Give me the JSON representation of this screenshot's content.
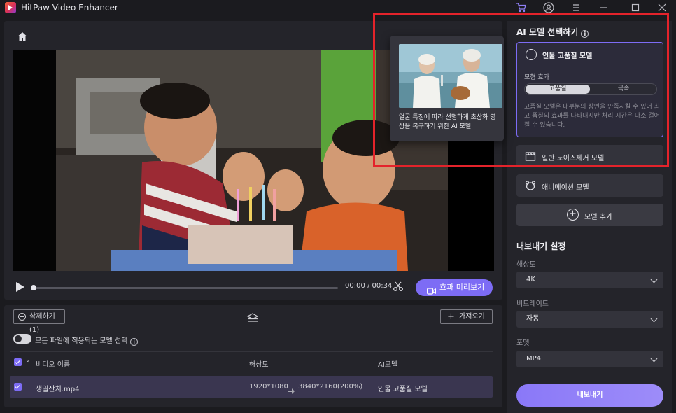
{
  "app": {
    "title": "HitPaw Video Enhancer"
  },
  "titlebar_icons": [
    "cart-icon",
    "account-icon",
    "menu-icon",
    "minimize-icon",
    "maximize-icon",
    "close-icon"
  ],
  "player": {
    "time": "00:00 / 00:34",
    "progress": 0.0,
    "preview_label": "효과 미리보기"
  },
  "file_list": {
    "delete_label": "삭제하기(1)",
    "import_label": "가져오기",
    "apply_all_label": "모든 파일에 적용되는 모델 선택",
    "apply_all_on": false,
    "columns": {
      "name": "비디오 이름",
      "resolution": "해상도",
      "model": "AI모델"
    },
    "rows": [
      {
        "name": "생일잔치.mp4",
        "res_from": "1920*1080",
        "res_to": "3840*2160(200%)",
        "model": "인물 고품질 모델",
        "checked": true
      }
    ]
  },
  "models": {
    "title": "AI 모델 선택하기",
    "active": {
      "title": "인물 고품질 모델",
      "effect_label": "모형 효과",
      "options": [
        "고품질",
        "극속"
      ],
      "selected": "고품질",
      "description": "고품질 모델은 대부분의 장면을 만족시킬 수 있어 최고 품질의 효과를 나타내지만 처리 시간은 다소 걸어질 수 있습니다."
    },
    "others": [
      {
        "label": "일반 노이즈제거 모델",
        "icon": "clapper-icon"
      },
      {
        "label": "애니메이션 모델",
        "icon": "bear-icon"
      }
    ],
    "add_label": "모델 추가"
  },
  "tooltip": {
    "text": "얼굴 특징에 따라 선명하게 초상화 영상을 복구하기 위한 AI 모델"
  },
  "export": {
    "title": "내보내기 설정",
    "resolution_label": "해상도",
    "resolution": "4K",
    "bitrate_label": "비트레이트",
    "bitrate": "자동",
    "format_label": "포멧",
    "format": "MP4",
    "button_label": "내보내기"
  },
  "colors": {
    "accent": "#7d6cf5",
    "highlight": "#e4232b",
    "panel": "#24242a",
    "bg": "#1b1b1f"
  }
}
